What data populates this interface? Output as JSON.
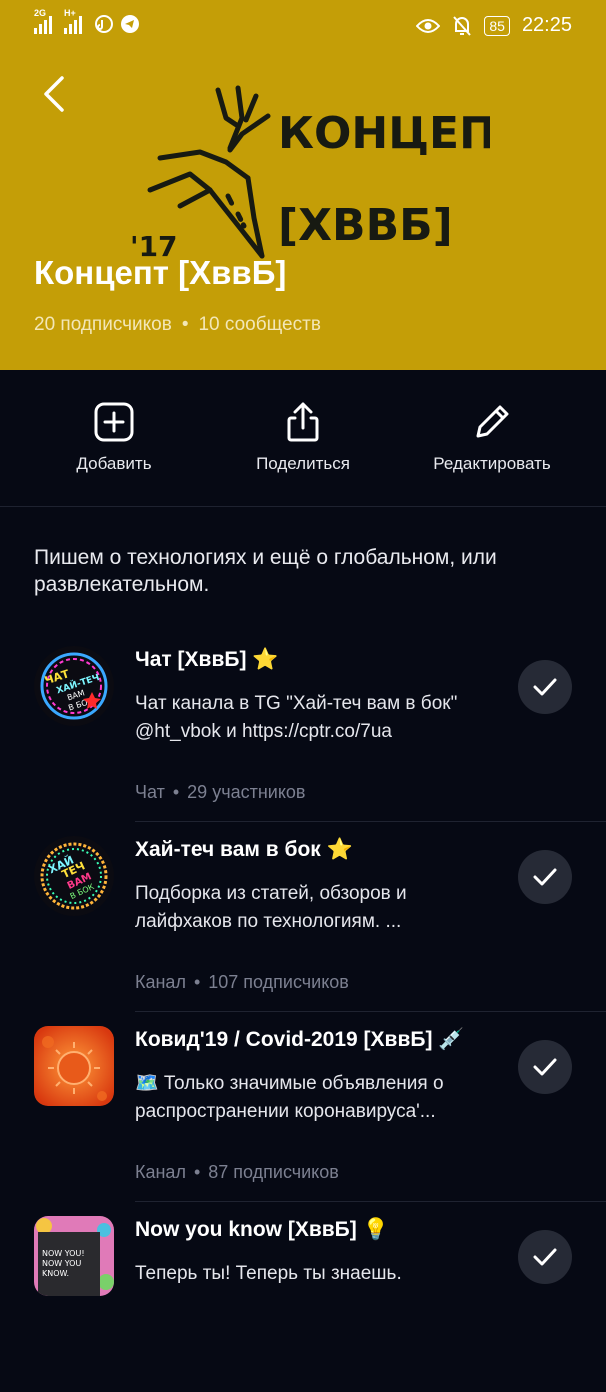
{
  "status_bar": {
    "network_1": "2G",
    "network_2": "H+",
    "battery": "85",
    "time": "22:25"
  },
  "header": {
    "logo_word_1": "КОНЦЕПТ",
    "logo_word_2": "[ХВВБ]",
    "logo_year": "'17",
    "title": "Концепт [ХввБ]",
    "subscribers": "20 подписчиков",
    "communities": "10 сообществ",
    "background_color": "#c49e07"
  },
  "actions": [
    {
      "label": "Добавить",
      "icon": "add-square-icon"
    },
    {
      "label": "Поделиться",
      "icon": "share-icon"
    },
    {
      "label": "Редактировать",
      "icon": "pencil-icon"
    }
  ],
  "description": "Пишем о технологиях и ещё о глобальном, или развлекательном.",
  "items": [
    {
      "title": "Чат [ХввБ] ⭐",
      "description": "Чат канала в TG \"Хай-теч вам в бок\" @ht_vbok и https://cptr.co/7ua",
      "type": "Чат",
      "count": "29 участников",
      "avatar_text": [
        "ЧАТ",
        "ХАЙ-ТЕЧ",
        "ВАМ",
        "В БОК"
      ]
    },
    {
      "title": "Хай-теч вам в бок ⭐",
      "description": "Подборка из статей, обзоров и лайфхаков по технологиям. ...",
      "type": "Канал",
      "count": "107 подписчиков",
      "avatar_text": [
        "ХАЙ",
        "ТЕЧ",
        "ВАМ",
        "В БОК"
      ]
    },
    {
      "title": "Ковид'19 / Covid-2019 [ХввБ] 💉",
      "description": "🗺️  Только значимые объявления о распространении коронавируса'...",
      "type": "Канал",
      "count": "87 подписчиков"
    },
    {
      "title": "Now you know [ХввБ] 💡",
      "description": "Теперь ты! Теперь ты знаешь.",
      "avatar_text": [
        "NOW YOU!",
        "NOW YOU",
        "KNOW."
      ]
    }
  ]
}
